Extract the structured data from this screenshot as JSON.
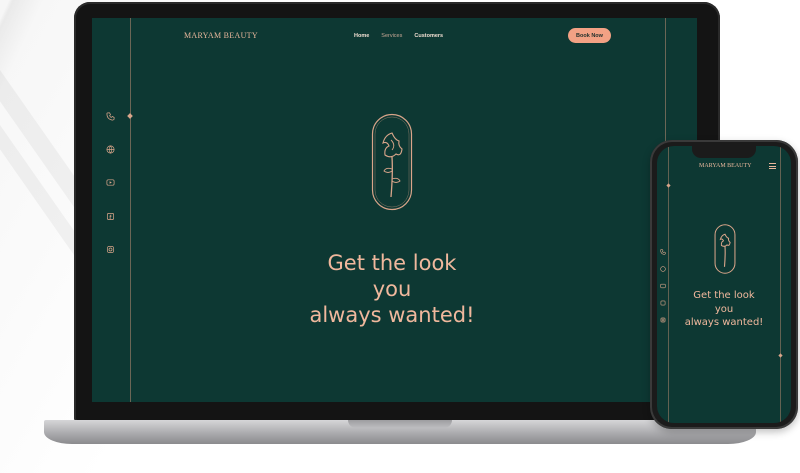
{
  "laptop": {
    "brand": "MARYAM BEAUTY",
    "nav": [
      {
        "label": "Home",
        "active": true
      },
      {
        "label": "Services",
        "active": false
      },
      {
        "label": "Customers",
        "active": true
      }
    ],
    "cta_label": "Book Now",
    "social_icons": [
      "phone-icon",
      "globe-icon",
      "youtube-icon",
      "facebook-icon",
      "instagram-icon"
    ],
    "headline_lines": [
      "Get the look",
      "you",
      "always wanted!"
    ]
  },
  "phone": {
    "brand": "MARYAM BEAUTY",
    "menu_icon": "hamburger-menu-icon",
    "social_icons": [
      "phone-icon",
      "globe-icon",
      "youtube-icon",
      "facebook-icon",
      "instagram-icon"
    ],
    "headline_lines": [
      "Get the look",
      "you",
      "always wanted!"
    ]
  },
  "colors": {
    "background": "#0d3833",
    "accent": "#f0b89d",
    "button": "#f2a184"
  }
}
